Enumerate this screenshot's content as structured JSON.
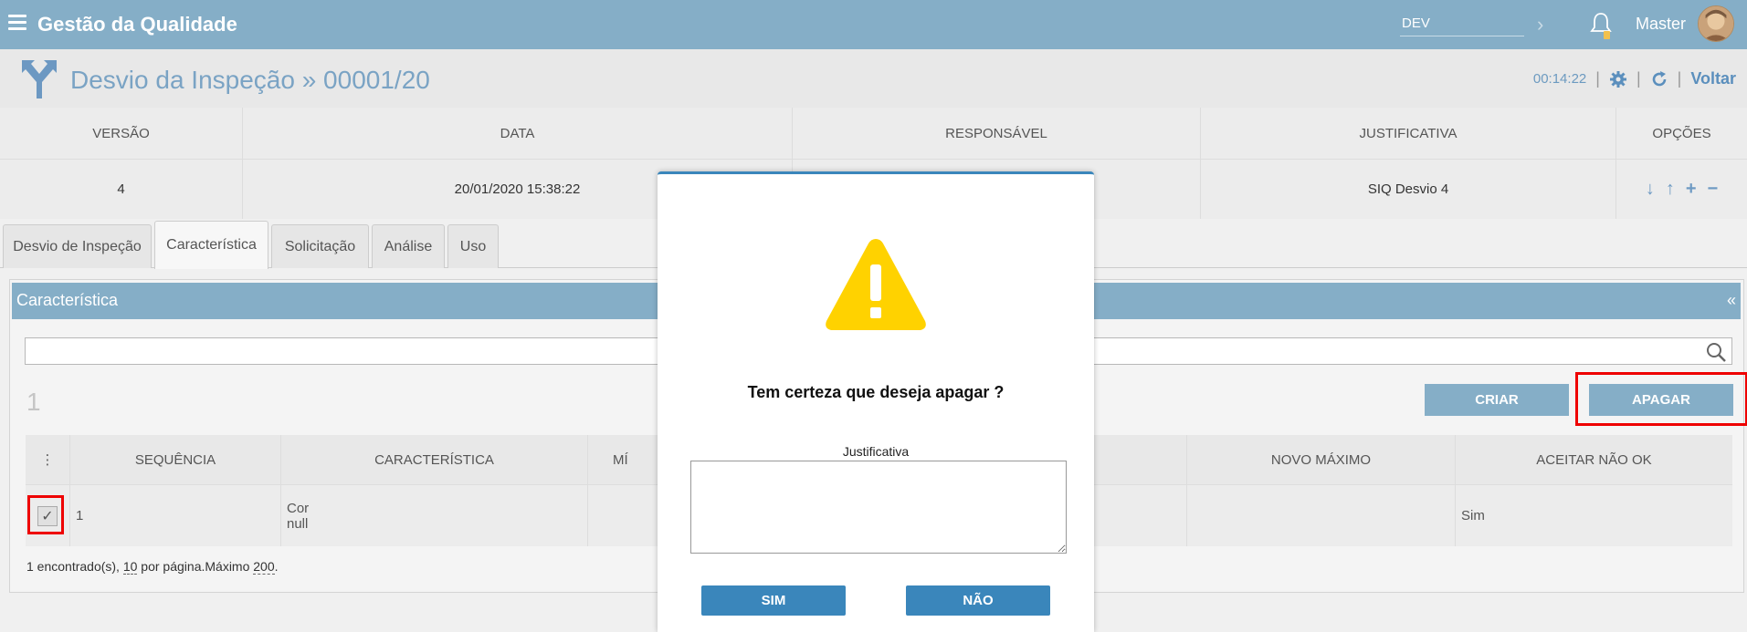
{
  "app": {
    "title": "Gestão da Qualidade",
    "env": "DEV",
    "user": "Master"
  },
  "page": {
    "title": "Desvio da Inspeção » 00001/20",
    "time": "00:14:22",
    "back": "Voltar"
  },
  "version_table": {
    "headers": [
      "VERSÃO",
      "DATA",
      "RESPONSÁVEL",
      "JUSTIFICATIVA",
      "OPÇÕES"
    ],
    "row": {
      "versao": "4",
      "data": "20/01/2020 15:38:22",
      "responsavel": "",
      "justificativa": "SIQ Desvio 4"
    }
  },
  "tabs": [
    "Desvio de Inspeção",
    "Característica",
    "Solicitação",
    "Análise",
    "Uso"
  ],
  "panel": {
    "title": "Característica",
    "collapse": "«",
    "count": "1",
    "btn_criar": "CRIAR",
    "btn_apagar": "APAGAR",
    "grid_headers": [
      "⋮",
      "SEQUÊNCIA",
      "CARACTERÍSTICA",
      "MÍ",
      "NOVO MÁXIMO",
      "ACEITAR NÃO OK"
    ],
    "row": {
      "check": "✓",
      "sequencia": "1",
      "caracteristica_line1": "Cor",
      "caracteristica_line2": "null",
      "aceitar": "Sim"
    },
    "footer": {
      "prefix": "1 encontrado(s), ",
      "per_page": "10",
      "mid": " por página.Máximo ",
      "max": "200",
      "suffix": "."
    }
  },
  "modal": {
    "question": "Tem certeza que deseja apagar ?",
    "just_label": "Justificativa",
    "just_value": "",
    "btn_yes": "SIM",
    "btn_no": "NÃO"
  }
}
